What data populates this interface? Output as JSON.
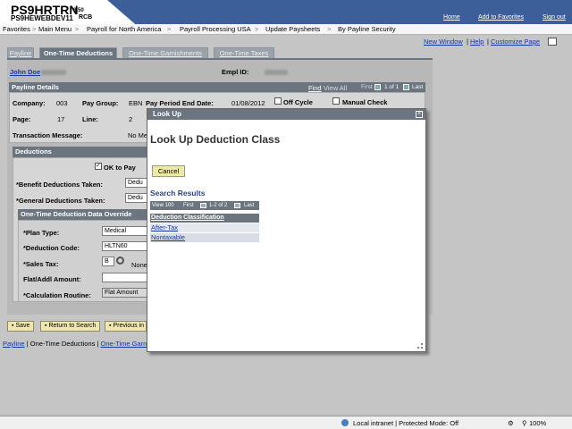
{
  "header": {
    "title": "PS9HRTRN",
    "version": "8.50",
    "server": "PS9HEWEBDEV11",
    "server_suffix": "RCB",
    "links": [
      "Home",
      "Add to Favorites",
      "Sign out"
    ]
  },
  "nav": {
    "items": [
      "Favorites",
      "Main Menu",
      "Payroll for North America",
      "Payroll Processing USA",
      "Update Paysheets",
      "By Payline Security"
    ],
    "separator": ">"
  },
  "toplinks": {
    "new_window": "New Window",
    "help": "Help",
    "customize": "Customize Page",
    "sep": "|"
  },
  "tabs": [
    "Payline",
    "One-Time Deductions",
    "One-Time Garnishments",
    "One-Time Taxes"
  ],
  "employee": {
    "name": "John Doe",
    "empl_id_label": "Empl ID:"
  },
  "payline": {
    "section_title": "Payline Details",
    "find": "Find",
    "view_all": "View All",
    "first": "First",
    "counter": "1 of 1",
    "last": "Last",
    "company_label": "Company:",
    "company": "003",
    "pay_group_label": "Pay Group:",
    "pay_group": "EBN",
    "pay_end_label": "Pay Period End Date:",
    "pay_end": "01/08/2012",
    "off_cycle": "Off Cycle",
    "manual_check": "Manual Check",
    "page_label": "Page:",
    "page": "17",
    "line_label": "Line:",
    "line": "2",
    "txn_label": "Transaction Message:",
    "txn_value": "No Me"
  },
  "deductions": {
    "section_title": "Deductions",
    "ok_to_pay": "OK to Pay",
    "benefit_label": "*Benefit Deductions Taken:",
    "benefit_value": "Dedu",
    "general_label": "*General Deductions Taken:",
    "general_value": "Dedu"
  },
  "override": {
    "section_title": "One-Time Deduction Data Override",
    "plan_type_label": "*Plan Type:",
    "plan_type": "Medical",
    "ded_code_label": "*Deduction Code:",
    "ded_code": "HLTN60",
    "sales_tax_label": "*Sales Tax:",
    "sales_tax": "B",
    "sales_tax_desc": "None",
    "flat_label": "Flat/Addl Amount:",
    "flat_value": "",
    "calc_label": "*Calculation Routine:",
    "calc_value": "Flat Amount"
  },
  "buttons": {
    "save": "Save",
    "return": "Return to Search",
    "previous": "Previous in"
  },
  "bottom_links": [
    "Payline",
    "One-Time Deductions",
    "One-Time Garn"
  ],
  "modal": {
    "bar_title": "Look Up",
    "title": "Look Up Deduction Class",
    "cancel": "Cancel",
    "search_results": "Search Results",
    "grid": {
      "view": "View 100",
      "first": "First",
      "counter": "1-2 of 2",
      "last": "Last"
    },
    "column": "Deduction Classification",
    "rows": [
      "After-Tax",
      "Nontaxable"
    ]
  },
  "statusbar": {
    "zone": "Local intranet | Protected Mode: Off",
    "zoom": "100%"
  }
}
